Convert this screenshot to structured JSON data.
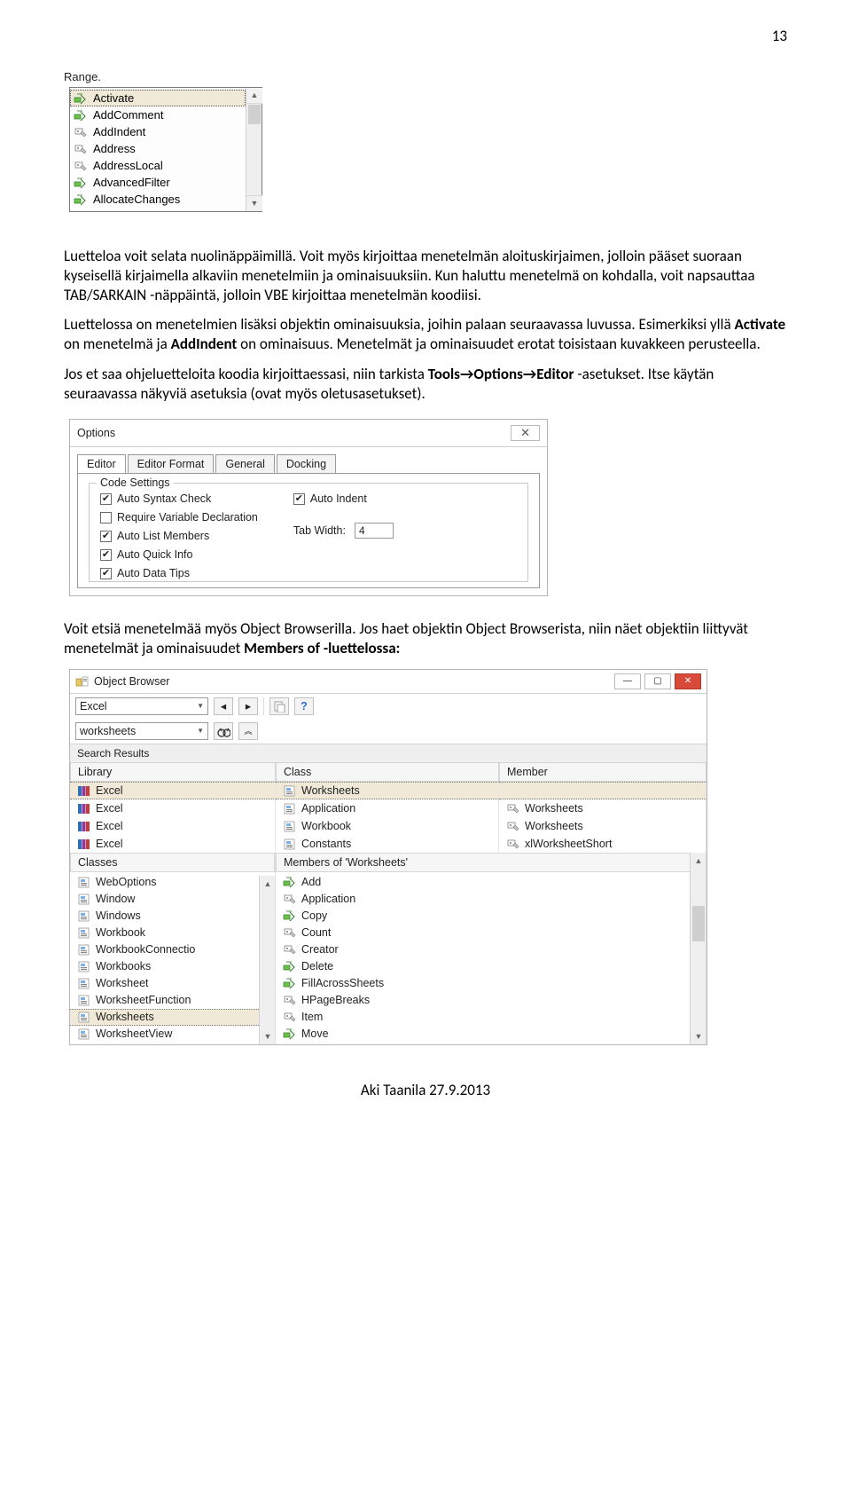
{
  "page_number": "13",
  "range_label": "Range.",
  "intellisense": [
    {
      "name": "Activate",
      "type": "method",
      "selected": true
    },
    {
      "name": "AddComment",
      "type": "method"
    },
    {
      "name": "AddIndent",
      "type": "prop"
    },
    {
      "name": "Address",
      "type": "prop"
    },
    {
      "name": "AddressLocal",
      "type": "prop"
    },
    {
      "name": "AdvancedFilter",
      "type": "method"
    },
    {
      "name": "AllocateChanges",
      "type": "method"
    }
  ],
  "para1_a": "Luetteloa voit selata nuolinäppäimillä. Voit myös kirjoittaa menetelmän aloituskirjaimen, jolloin pääset suoraan kyseisellä kirjaimella alkaviin menetelmiin ja ominaisuuksiin. Kun haluttu menetelmä on kohdalla, voit napsauttaa ",
  "para1_b": " -näppäintä, jolloin VBE kirjoittaa menetelmän koodiisi.",
  "tabsarkain": "TAB/SARKAIN",
  "para2_a": "Luettelossa on menetelmien lisäksi objektin ominaisuuksia, joihin palaan seuraavassa luvussa. Esimerkiksi yllä ",
  "para2_b": " on menetelmä ja ",
  "para2_c": " on ominaisuus. Menetelmät ja ominaisuudet erotat toisistaan kuvakkeen perusteella.",
  "bold_activate": "Activate",
  "bold_addindent": "AddIndent",
  "para3_a": "Jos et saa ohjeluetteloita koodia kirjoittaessasi, niin tarkista ",
  "para3_b": " -asetukset. Itse käytän seuraavassa näkyviä asetuksia (ovat myös oletusasetukset).",
  "bold_tools": "Tools→Options→Editor",
  "options": {
    "title": "Options",
    "tabs": [
      "Editor",
      "Editor Format",
      "General",
      "Docking"
    ],
    "legend": "Code Settings",
    "left": [
      {
        "label": "Auto Syntax Check",
        "checked": true
      },
      {
        "label": "Require Variable Declaration",
        "checked": false
      },
      {
        "label": "Auto List Members",
        "checked": true
      },
      {
        "label": "Auto Quick Info",
        "checked": true
      },
      {
        "label": "Auto Data Tips",
        "checked": true
      }
    ],
    "right": {
      "auto_indent": "Auto Indent",
      "auto_indent_checked": true,
      "tab_label": "Tab Width:",
      "tab_value": "4"
    }
  },
  "para4": "Voit etsiä menetelmää myös Object Browserilla. Jos haet objektin Object Browserista, niin näet objektiin liittyvät menetelmät ja ominaisuudet ",
  "para4_bold": "Members of -luettelossa:",
  "ob": {
    "title": "Object Browser",
    "project": "Excel",
    "search": "worksheets",
    "search_results": "Search Results",
    "headers3": [
      "Library",
      "Class",
      "Member"
    ],
    "rows": [
      {
        "lib": "Excel",
        "cls": "Worksheets",
        "mem": "",
        "sel": true,
        "ctype": "class",
        "mtype": ""
      },
      {
        "lib": "Excel",
        "cls": "Application",
        "mem": "Worksheets",
        "ctype": "class",
        "mtype": "prop"
      },
      {
        "lib": "Excel",
        "cls": "Workbook",
        "mem": "Worksheets",
        "ctype": "class",
        "mtype": "prop"
      },
      {
        "lib": "Excel",
        "cls": "Constants",
        "mem": "xlWorksheetShort",
        "ctype": "class",
        "mtype": "prop"
      }
    ],
    "classes_hdr": "Classes",
    "members_hdr": "Members of 'Worksheets'",
    "classes": [
      {
        "n": "WebOptions",
        "t": "class"
      },
      {
        "n": "Window",
        "t": "class"
      },
      {
        "n": "Windows",
        "t": "class"
      },
      {
        "n": "Workbook",
        "t": "class"
      },
      {
        "n": "WorkbookConnectio",
        "t": "class"
      },
      {
        "n": "Workbooks",
        "t": "class"
      },
      {
        "n": "Worksheet",
        "t": "class"
      },
      {
        "n": "WorksheetFunction",
        "t": "class"
      },
      {
        "n": "Worksheets",
        "t": "class",
        "sel": true
      },
      {
        "n": "WorksheetView",
        "t": "class"
      }
    ],
    "members": [
      {
        "n": "Add",
        "t": "method"
      },
      {
        "n": "Application",
        "t": "prop"
      },
      {
        "n": "Copy",
        "t": "method"
      },
      {
        "n": "Count",
        "t": "prop"
      },
      {
        "n": "Creator",
        "t": "prop"
      },
      {
        "n": "Delete",
        "t": "method"
      },
      {
        "n": "FillAcrossSheets",
        "t": "method"
      },
      {
        "n": "HPageBreaks",
        "t": "prop"
      },
      {
        "n": "Item",
        "t": "prop"
      },
      {
        "n": "Move",
        "t": "method"
      }
    ]
  },
  "footer": "Aki Taanila 27.9.2013"
}
